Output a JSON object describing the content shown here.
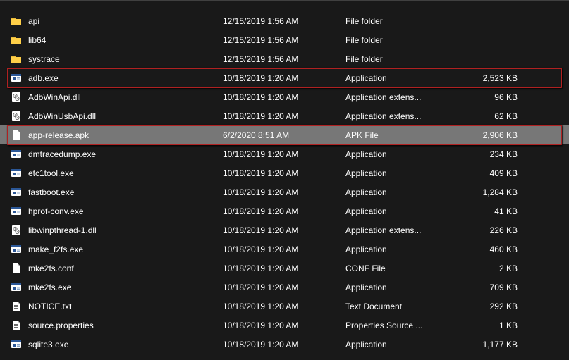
{
  "files": [
    {
      "name": "api",
      "date": "12/15/2019 1:56 AM",
      "type": "File folder",
      "size": "",
      "icon": "folder-icon",
      "highlight": false,
      "selected": false
    },
    {
      "name": "lib64",
      "date": "12/15/2019 1:56 AM",
      "type": "File folder",
      "size": "",
      "icon": "folder-icon",
      "highlight": false,
      "selected": false
    },
    {
      "name": "systrace",
      "date": "12/15/2019 1:56 AM",
      "type": "File folder",
      "size": "",
      "icon": "folder-icon",
      "highlight": false,
      "selected": false
    },
    {
      "name": "adb.exe",
      "date": "10/18/2019 1:20 AM",
      "type": "Application",
      "size": "2,523 KB",
      "icon": "exe-icon",
      "highlight": true,
      "selected": false
    },
    {
      "name": "AdbWinApi.dll",
      "date": "10/18/2019 1:20 AM",
      "type": "Application extens...",
      "size": "96 KB",
      "icon": "dll-icon",
      "highlight": false,
      "selected": false
    },
    {
      "name": "AdbWinUsbApi.dll",
      "date": "10/18/2019 1:20 AM",
      "type": "Application extens...",
      "size": "62 KB",
      "icon": "dll-icon",
      "highlight": false,
      "selected": false
    },
    {
      "name": "app-release.apk",
      "date": "6/2/2020 8:51 AM",
      "type": "APK File",
      "size": "2,906 KB",
      "icon": "file-icon",
      "highlight": true,
      "selected": true
    },
    {
      "name": "dmtracedump.exe",
      "date": "10/18/2019 1:20 AM",
      "type": "Application",
      "size": "234 KB",
      "icon": "exe-icon",
      "highlight": false,
      "selected": false
    },
    {
      "name": "etc1tool.exe",
      "date": "10/18/2019 1:20 AM",
      "type": "Application",
      "size": "409 KB",
      "icon": "exe-icon",
      "highlight": false,
      "selected": false
    },
    {
      "name": "fastboot.exe",
      "date": "10/18/2019 1:20 AM",
      "type": "Application",
      "size": "1,284 KB",
      "icon": "exe-icon",
      "highlight": false,
      "selected": false
    },
    {
      "name": "hprof-conv.exe",
      "date": "10/18/2019 1:20 AM",
      "type": "Application",
      "size": "41 KB",
      "icon": "exe-icon",
      "highlight": false,
      "selected": false
    },
    {
      "name": "libwinpthread-1.dll",
      "date": "10/18/2019 1:20 AM",
      "type": "Application extens...",
      "size": "226 KB",
      "icon": "dll-icon",
      "highlight": false,
      "selected": false
    },
    {
      "name": "make_f2fs.exe",
      "date": "10/18/2019 1:20 AM",
      "type": "Application",
      "size": "460 KB",
      "icon": "exe-icon",
      "highlight": false,
      "selected": false
    },
    {
      "name": "mke2fs.conf",
      "date": "10/18/2019 1:20 AM",
      "type": "CONF File",
      "size": "2 KB",
      "icon": "file-icon",
      "highlight": false,
      "selected": false
    },
    {
      "name": "mke2fs.exe",
      "date": "10/18/2019 1:20 AM",
      "type": "Application",
      "size": "709 KB",
      "icon": "exe-icon",
      "highlight": false,
      "selected": false
    },
    {
      "name": "NOTICE.txt",
      "date": "10/18/2019 1:20 AM",
      "type": "Text Document",
      "size": "292 KB",
      "icon": "txt-icon",
      "highlight": false,
      "selected": false
    },
    {
      "name": "source.properties",
      "date": "10/18/2019 1:20 AM",
      "type": "Properties Source ...",
      "size": "1 KB",
      "icon": "txt-icon",
      "highlight": false,
      "selected": false
    },
    {
      "name": "sqlite3.exe",
      "date": "10/18/2019 1:20 AM",
      "type": "Application",
      "size": "1,177 KB",
      "icon": "exe-icon",
      "highlight": false,
      "selected": false
    }
  ],
  "icons": {
    "folder-icon": "<svg viewBox='0 0 16 16'><path fill='#ffcf48' d='M1 3h5l1.5 2H15v8.5H1z'/><path fill='#e8b93a' d='M1 3h5l1.5 2H1z'/></svg>",
    "exe-icon": "<svg viewBox='0 0 16 16'><rect x='1' y='2' width='14' height='11' rx='1' fill='#ffffff'/><rect x='1' y='2' width='14' height='3' fill='#2b5797'/><rect x='3' y='7' width='4' height='4' fill='#2b5797'/><rect x='9' y='7' width='4' height='1.5' fill='#89a6c9'/><rect x='9' y='9.5' width='4' height='1.5' fill='#89a6c9'/></svg>",
    "dll-icon": "<svg viewBox='0 0 16 16'><rect x='2' y='1' width='12' height='14' rx='1' fill='#ffffff'/><circle cx='6.5' cy='6' r='2.6' fill='none' stroke='#6b6b6b' stroke-width='1'/><circle cx='9.5' cy='10' r='2.6' fill='none' stroke='#6b6b6b' stroke-width='1'/><circle cx='6.5' cy='6' r='0.8' fill='#6b6b6b'/><circle cx='9.5' cy='10' r='0.8' fill='#6b6b6b'/></svg>",
    "file-icon": "<svg viewBox='0 0 16 16'><path fill='#ffffff' d='M3 1h7l3 3v11H3z'/><path fill='#cfcfcf' d='M10 1v3h3z'/></svg>",
    "txt-icon": "<svg viewBox='0 0 16 16'><path fill='#ffffff' d='M3 1h7l3 3v11H3z'/><path fill='#cfcfcf' d='M10 1v3h3z'/><rect x='5' y='6' width='6' height='1' fill='#6b6b6b'/><rect x='5' y='8' width='6' height='1' fill='#6b6b6b'/><rect x='5' y='10' width='6' height='1' fill='#6b6b6b'/></svg>"
  }
}
